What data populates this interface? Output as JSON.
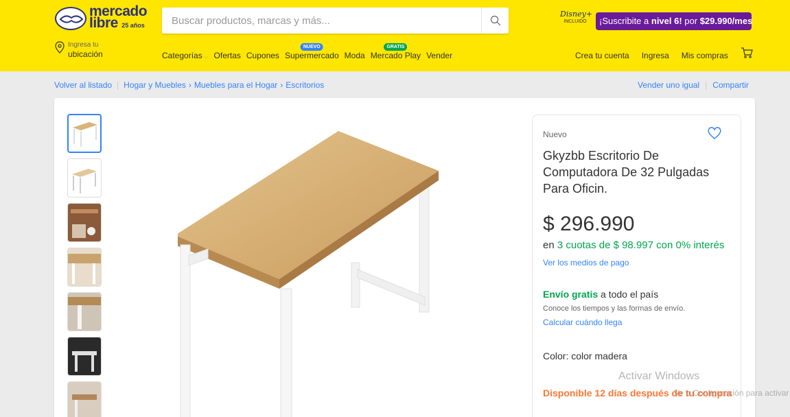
{
  "brand": {
    "line1": "mercado",
    "line2": "libre",
    "years": "25 años"
  },
  "search": {
    "placeholder": "Buscar productos, marcas y más..."
  },
  "disney": {
    "logo": "Disney+",
    "sub": "INCLUIDO"
  },
  "promo": {
    "pre": "¡Suscribite a ",
    "level": "nivel 6!",
    "mid": " por ",
    "price": "$29.990/mes"
  },
  "location": {
    "line1": "Ingresa tu",
    "line2": "ubicación"
  },
  "nav": {
    "categorias": "Categorías",
    "ofertas": "Ofertas",
    "cupones": "Cupones",
    "supermercado": "Supermercado",
    "supermercado_tag": "NUEVO",
    "moda": "Moda",
    "mercado_play": "Mercado Play",
    "mercado_play_tag": "GRATIS",
    "vender": "Vender"
  },
  "account": {
    "crear": "Crea tu cuenta",
    "ingresa": "Ingresa",
    "compras": "Mis compras"
  },
  "breadcrumb": {
    "back": "Volver al listado",
    "items": [
      "Hogar y Muebles",
      "Muebles para el Hogar",
      "Escritorios"
    ]
  },
  "actions": {
    "vender_igual": "Vender uno igual",
    "compartir": "Compartir"
  },
  "product": {
    "condition": "Nuevo",
    "title": "Gkyzbb Escritorio De Computadora De 32 Pulgadas Para Oficin.",
    "price": "$ 296.990",
    "installments_prefix": "en ",
    "installments": "3 cuotas de $ 98.997 con 0% interés",
    "payment_link": "Ver los medios de pago",
    "shipping_free": "Envío gratis",
    "shipping_rest": " a todo el país",
    "shipping_info": "Conoce los tiempos y las formas de envío.",
    "shipping_calc": "Calcular cuándo llega",
    "color_label": "Color: ",
    "color_value": "color madera",
    "availability": "Disponible 12 días después de tu compra"
  },
  "watermark": {
    "line1": "Activar Windows",
    "line2": "Ve a Configuración para activar Windows."
  },
  "colors": {
    "header": "#ffe600",
    "link": "#3483fa",
    "green": "#00a650",
    "orange": "#ff7733",
    "promo": "#6a1b9a"
  }
}
